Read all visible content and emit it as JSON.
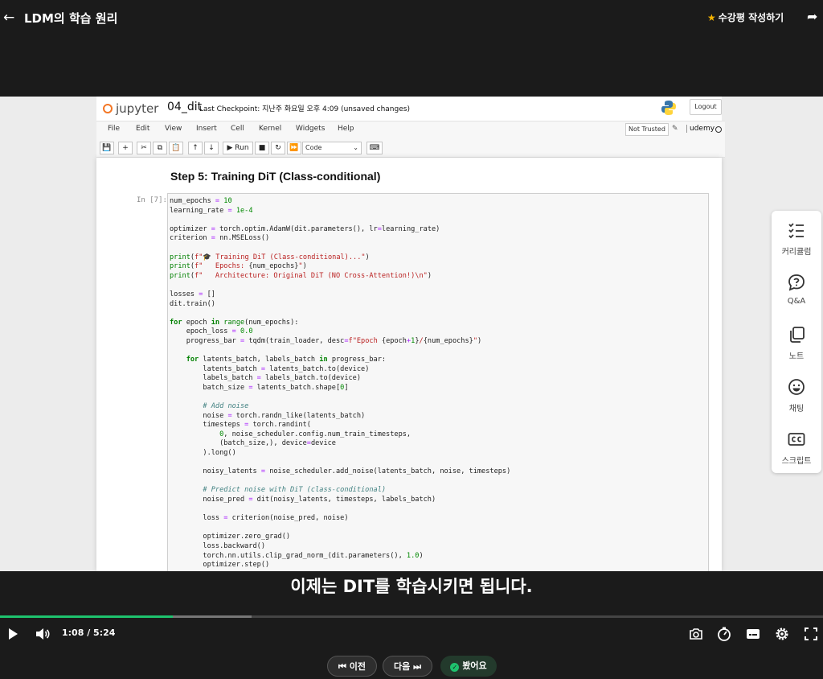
{
  "topbar": {
    "title": "LDM의 학습 원리",
    "review_label": "수강평 작성하기"
  },
  "notebook": {
    "logo_text": "jupyter",
    "name": "04_dit",
    "checkpoint_label": "Last Checkpoint:",
    "checkpoint_time": "지난주 화요일 오후 4:09",
    "unsaved": "(unsaved changes)",
    "logout": "Logout",
    "menu": [
      "File",
      "Edit",
      "View",
      "Insert",
      "Cell",
      "Kernel",
      "Widgets",
      "Help"
    ],
    "not_trusted": "Not Trusted",
    "kernel": "udemy",
    "run_label": "Run",
    "cell_type": "Code",
    "heading": "Step 5: Training DiT (Class-conditional)",
    "prompt": "In [7]:"
  },
  "sidepanel": {
    "items": [
      {
        "label": "커리큘럼",
        "icon": "checklist-icon"
      },
      {
        "label": "Q&A",
        "icon": "question-icon"
      },
      {
        "label": "노트",
        "icon": "note-icon"
      },
      {
        "label": "채팅",
        "icon": "smile-icon"
      },
      {
        "label": "스크립트",
        "icon": "cc-icon"
      }
    ]
  },
  "subtitle": "이제는 DIT를 학습시키면 됩니다.",
  "player": {
    "time": "1:08 / 5:24",
    "progress": 0.21
  },
  "nav": {
    "prev": "이전",
    "next": "다음",
    "seen": "봤어요"
  },
  "colors": {
    "accent": "#1ec36e",
    "star": "#f5b400",
    "jupyter_orange": "#f37726"
  }
}
